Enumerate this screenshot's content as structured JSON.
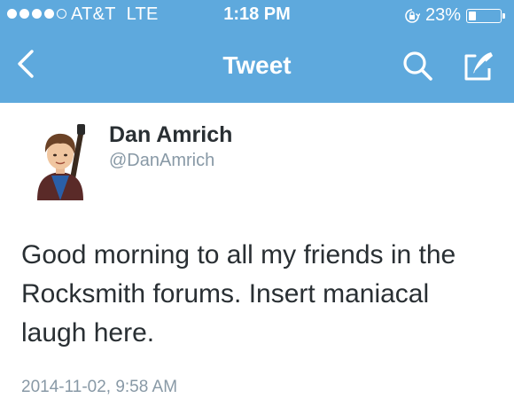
{
  "status_bar": {
    "carrier": "AT&T",
    "network": "LTE",
    "time": "1:18 PM",
    "battery_percent": "23%",
    "battery_level": 0.23,
    "signal_bars_filled": 4,
    "signal_bars_total": 5
  },
  "nav": {
    "title": "Tweet",
    "back_icon": "chevron-left-icon",
    "search_icon": "search-icon",
    "compose_icon": "compose-icon"
  },
  "tweet": {
    "author_name": "Dan Amrich",
    "author_handle": "@DanAmrich",
    "text": "Good morning to all my friends in the Rocksmith forums. Insert maniacal laugh here.",
    "timestamp": "2014-11-02, 9:58 AM"
  },
  "colors": {
    "bar_background": "#5ea9dd",
    "primary_text": "#292f33",
    "secondary_text": "#8899a6"
  }
}
